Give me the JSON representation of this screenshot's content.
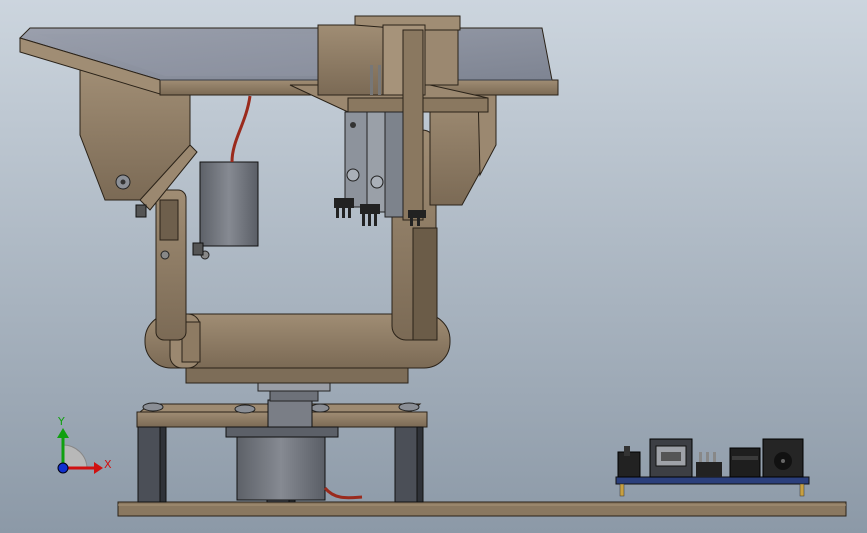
{
  "triad": {
    "x_label": "X",
    "y_label": "Y"
  },
  "colors": {
    "bg_top": "#c9d2dc",
    "bg_bottom": "#8d9aa8",
    "wood": "#8c7a63",
    "wood_light": "#a6937a",
    "wood_dark": "#5e503f",
    "panel": "#8a909e",
    "servo": "#6f737a",
    "pcb": "#2a3f7a",
    "wire_red": "#9a2a1c",
    "axis_x": "#d01010",
    "axis_y": "#10a010",
    "axis_z": "#1030d0"
  }
}
